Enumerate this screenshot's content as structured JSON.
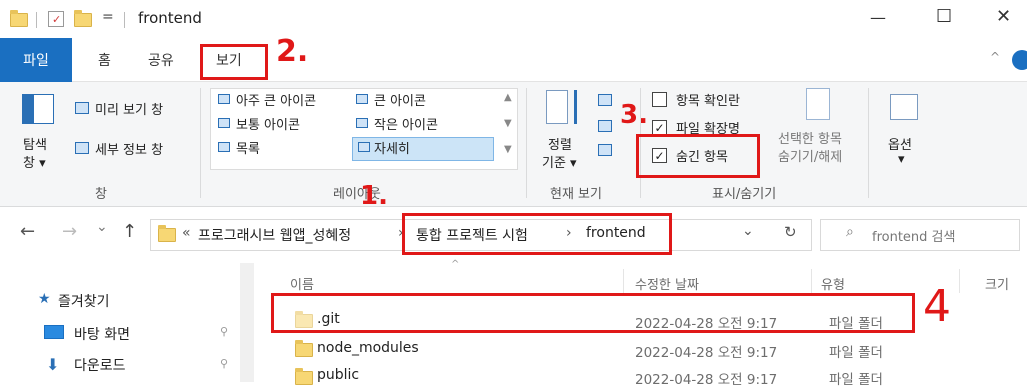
{
  "window": {
    "title": "frontend",
    "quick_access_arrow": "=",
    "minimize": "—",
    "maximize": "☐",
    "close": "✕"
  },
  "tabs": {
    "file": "파일",
    "home": "홈",
    "share": "공유",
    "view": "보기"
  },
  "ribbon": {
    "pane_group": {
      "nav_pane": "탐색\n창",
      "nav_pane_line1": "탐색",
      "nav_pane_line2": "창 ▾",
      "preview": "미리 보기 창",
      "details": "세부 정보 창",
      "label": "창"
    },
    "layout_group": {
      "items": [
        "아주 큰 아이콘",
        "큰 아이콘",
        "보통 아이콘",
        "작은 아이콘",
        "목록",
        "자세히"
      ],
      "label": "레이아웃"
    },
    "current_view": {
      "sort_line1": "정렬",
      "sort_line2": "기준 ▾",
      "label": "현재 보기"
    },
    "show_hide": {
      "item_checkboxes": "항목 확인란",
      "file_extensions": "파일 확장명",
      "hidden_items": "숨긴 항목",
      "hide_selected_line1": "선택한 항목",
      "hide_selected_line2": "숨기기/해제",
      "label": "표시/숨기기",
      "item_checkboxes_checked": false,
      "file_extensions_checked": true,
      "hidden_items_checked": true
    },
    "options": {
      "label": "옵션",
      "arrow": "▾"
    }
  },
  "address": {
    "back": "←",
    "forward": "→",
    "recent": "⌄",
    "up": "↑",
    "chevrons": "«",
    "crumbs": [
      "프로그래시브 웹앱_성혜정",
      "통합 프로젝트 시험",
      "frontend"
    ],
    "sep": "›",
    "dropdown": "⌄",
    "refresh": "↻",
    "search_placeholder": "frontend 검색"
  },
  "nav_pane": {
    "items": [
      {
        "label": "즐겨찾기"
      },
      {
        "label": "바탕 화면"
      },
      {
        "label": "다운로드"
      }
    ]
  },
  "columns": {
    "name": "이름",
    "date": "수정한 날짜",
    "type": "유형",
    "size": "크기"
  },
  "files": [
    {
      "name": ".git",
      "date": "2022-04-28 오전 9:17",
      "type": "파일 폴더"
    },
    {
      "name": "node_modules",
      "date": "2022-04-28 오전 9:17",
      "type": "파일 폴더"
    },
    {
      "name": "public",
      "date": "2022-04-28 오전 9:17",
      "type": "파일 폴더"
    }
  ],
  "annotations": {
    "one": "1.",
    "two": "2.",
    "three": "3.",
    "four": "4"
  },
  "colors": {
    "accent": "#1a6fc1",
    "annotation": "#e01818",
    "folder": "#f7d774"
  }
}
